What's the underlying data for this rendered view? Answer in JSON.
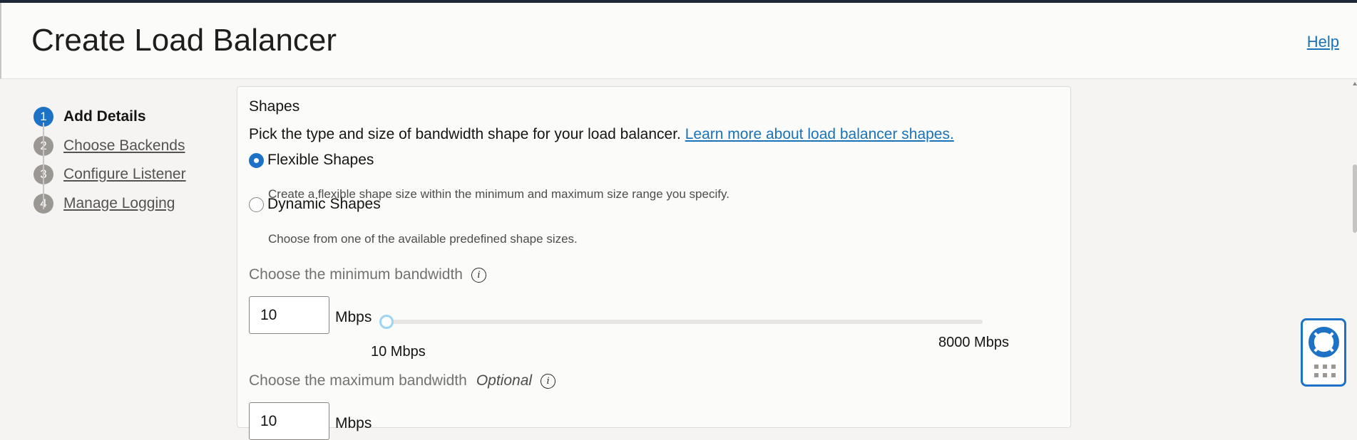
{
  "header": {
    "title": "Create Load Balancer",
    "help_link": "Help"
  },
  "steps": [
    {
      "number": "1",
      "label": "Add Details",
      "active": true
    },
    {
      "number": "2",
      "label": "Choose Backends",
      "active": false
    },
    {
      "number": "3",
      "label": "Configure Listener",
      "active": false
    },
    {
      "number": "4",
      "label": "Manage Logging",
      "active": false
    }
  ],
  "shapes": {
    "title": "Shapes",
    "description": "Pick the type and size of bandwidth shape for your load balancer.",
    "learn_more_link": "Learn more about load balancer shapes.",
    "options": [
      {
        "label": "Flexible Shapes",
        "help": "Create a flexible shape size within the minimum and maximum size range you specify.",
        "selected": true
      },
      {
        "label": "Dynamic Shapes",
        "help": "Choose from one of the available predefined shape sizes.",
        "selected": false
      }
    ]
  },
  "min_bandwidth": {
    "label": "Choose the minimum bandwidth",
    "value": "10",
    "unit": "Mbps",
    "slider_min_label": "10 Mbps",
    "slider_max_label": "8000 Mbps",
    "slider_value_fraction": 0
  },
  "max_bandwidth": {
    "label": "Choose the maximum bandwidth",
    "optional_label": "Optional",
    "value": "10",
    "unit": "Mbps"
  },
  "icons": {
    "info": "info-icon",
    "help_widget": "lifebuoy-icon",
    "apps": "grid-dots-icon"
  },
  "colors": {
    "accent": "#1e72c6",
    "link": "#1a73b9",
    "slider_thumb": "#9fd4f4"
  }
}
